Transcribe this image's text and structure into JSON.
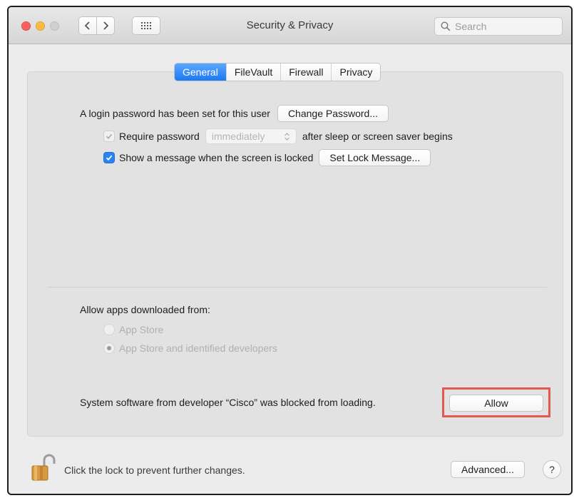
{
  "window": {
    "title": "Security & Privacy"
  },
  "toolbar": {
    "back_icon": "chevron-left-icon",
    "forward_icon": "chevron-right-icon",
    "grid_icon": "show-all-grid-icon",
    "search": {
      "placeholder": "Search",
      "value": ""
    }
  },
  "tabs": [
    {
      "label": "General",
      "active": true
    },
    {
      "label": "FileVault",
      "active": false
    },
    {
      "label": "Firewall",
      "active": false
    },
    {
      "label": "Privacy",
      "active": false
    }
  ],
  "general": {
    "login_text": "A login password has been set for this user",
    "change_password_label": "Change Password...",
    "require_password": {
      "label": "Require password",
      "checked": true,
      "enabled": false,
      "popup_value": "immediately",
      "suffix": "after sleep or screen saver begins"
    },
    "show_message": {
      "label": "Show a message when the screen is locked",
      "checked": true,
      "button_label": "Set Lock Message..."
    }
  },
  "allow_apps": {
    "title": "Allow apps downloaded from:",
    "options": [
      {
        "label": "App Store",
        "selected": false
      },
      {
        "label": "App Store and identified developers",
        "selected": true
      }
    ]
  },
  "blocked": {
    "text": "System software from developer “Cisco” was blocked from loading.",
    "allow_label": "Allow",
    "highlight_color": "#e05a4e"
  },
  "footer": {
    "lock_text": "Click the lock to prevent further changes.",
    "advanced_label": "Advanced...",
    "help_label": "?"
  },
  "colors": {
    "accent": "#1d79f2",
    "close": "#fc605b",
    "minimize": "#fdbc40",
    "zoom_disabled": "#d0d0d0"
  }
}
